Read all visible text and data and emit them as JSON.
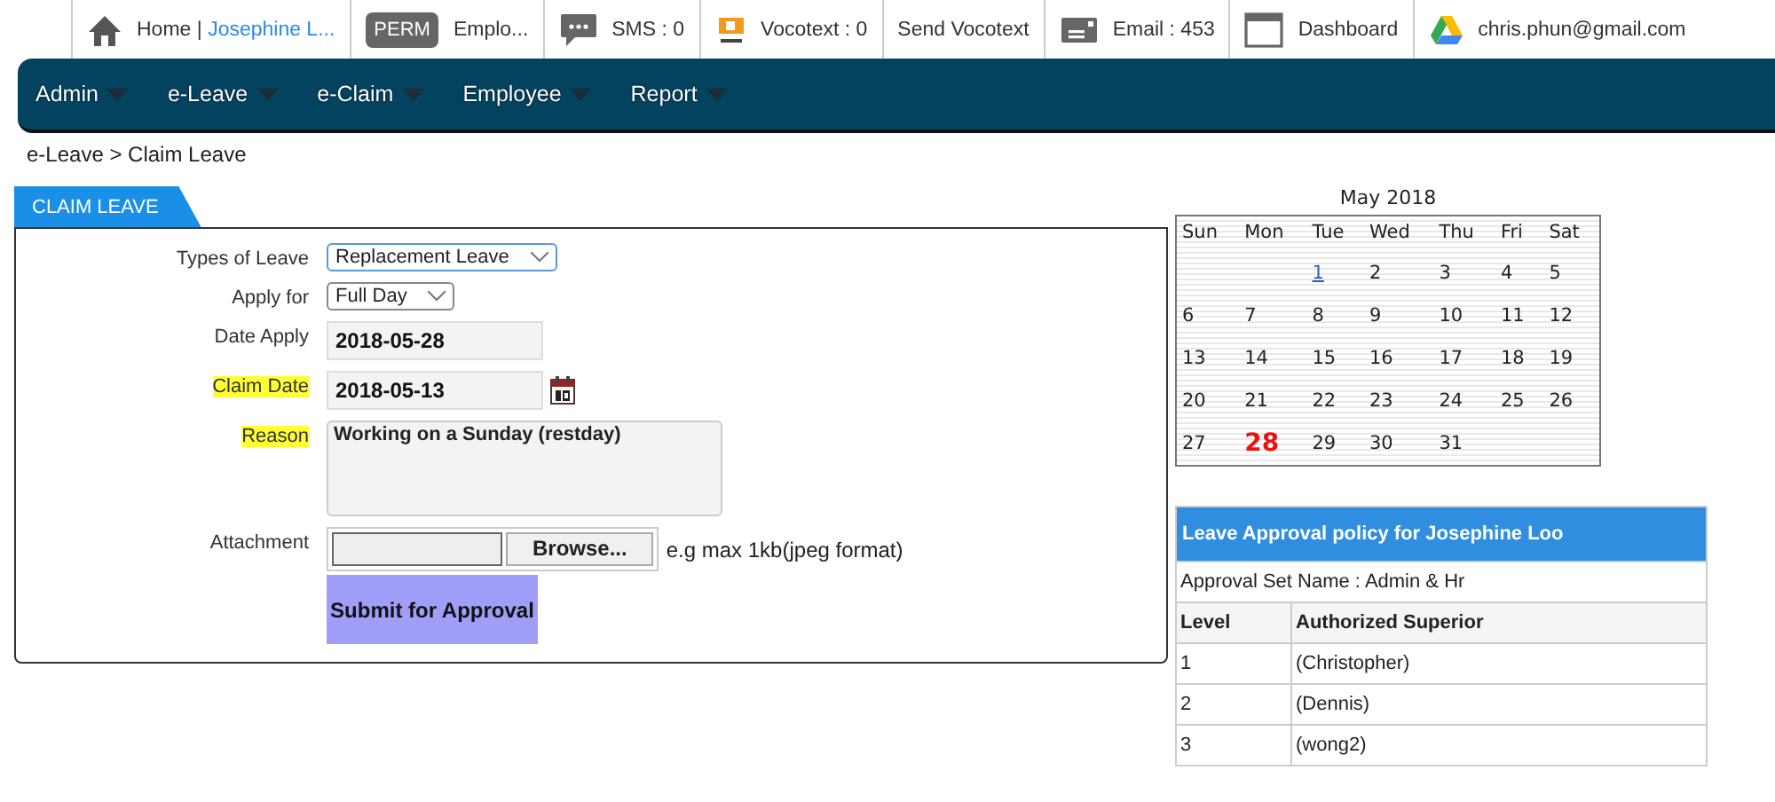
{
  "top_bar": [
    {
      "kind": "home",
      "text": "Home | ",
      "link": "Josephine L..."
    },
    {
      "kind": "badge",
      "badge": "PERM",
      "text": "Emplo..."
    },
    {
      "kind": "chat",
      "text": "SMS : 0"
    },
    {
      "kind": "vocotext",
      "text": "Vocotext : 0"
    },
    {
      "kind": "plain",
      "text": "Send Vocotext"
    },
    {
      "kind": "email",
      "text": "Email : 453"
    },
    {
      "kind": "window",
      "text": "Dashboard"
    },
    {
      "kind": "drive",
      "text": "chris.phun@gmail.com"
    }
  ],
  "menu": [
    {
      "label": "Admin"
    },
    {
      "label": "e-Leave"
    },
    {
      "label": "e-Claim"
    },
    {
      "label": "Employee"
    },
    {
      "label": "Report"
    }
  ],
  "breadcrumb": "e-Leave > Claim Leave",
  "form": {
    "tab": "CLAIM LEAVE",
    "fields": [
      {
        "kind": "select",
        "label": "Types of Leave",
        "highlighted": false,
        "value": "Replacement Leave",
        "focused": true
      },
      {
        "kind": "select",
        "label": "Apply for",
        "highlighted": false,
        "value": "Full Day",
        "focused": false
      },
      {
        "kind": "text",
        "label": "Date Apply",
        "highlighted": false,
        "value": "2018-05-28"
      },
      {
        "kind": "date",
        "label": "Claim Date",
        "highlighted": true,
        "value": "2018-05-13"
      },
      {
        "kind": "textarea",
        "label": "Reason",
        "highlighted": true,
        "value": "Working on a Sunday (restday)"
      },
      {
        "kind": "file",
        "label": "Attachment",
        "highlighted": false,
        "button": "Browse...",
        "hint": "e.g max 1kb(jpeg format)"
      }
    ],
    "submit": "Submit for Approval"
  },
  "calendar": {
    "title": "May 2018",
    "weekdays": [
      "Sun",
      "Mon",
      "Tue",
      "Wed",
      "Thu",
      "Fri",
      "Sat"
    ],
    "weeks": [
      [
        {
          "kind": "blank"
        },
        {
          "kind": "blank"
        },
        {
          "kind": "link",
          "day": "1"
        },
        {
          "kind": "day",
          "day": "2"
        },
        {
          "kind": "day",
          "day": "3"
        },
        {
          "kind": "day",
          "day": "4"
        },
        {
          "kind": "day",
          "day": "5"
        }
      ],
      [
        {
          "kind": "day",
          "day": "6"
        },
        {
          "kind": "day",
          "day": "7"
        },
        {
          "kind": "day",
          "day": "8"
        },
        {
          "kind": "day",
          "day": "9"
        },
        {
          "kind": "day",
          "day": "10"
        },
        {
          "kind": "day",
          "day": "11"
        },
        {
          "kind": "day",
          "day": "12"
        }
      ],
      [
        {
          "kind": "day",
          "day": "13"
        },
        {
          "kind": "day",
          "day": "14"
        },
        {
          "kind": "day",
          "day": "15"
        },
        {
          "kind": "day",
          "day": "16"
        },
        {
          "kind": "day",
          "day": "17"
        },
        {
          "kind": "day",
          "day": "18"
        },
        {
          "kind": "day",
          "day": "19"
        }
      ],
      [
        {
          "kind": "day",
          "day": "20"
        },
        {
          "kind": "day",
          "day": "21"
        },
        {
          "kind": "day",
          "day": "22"
        },
        {
          "kind": "day",
          "day": "23"
        },
        {
          "kind": "day",
          "day": "24"
        },
        {
          "kind": "day",
          "day": "25"
        },
        {
          "kind": "day",
          "day": "26"
        }
      ],
      [
        {
          "kind": "day",
          "day": "27"
        },
        {
          "kind": "today",
          "day": "28"
        },
        {
          "kind": "day",
          "day": "29"
        },
        {
          "kind": "day",
          "day": "30"
        },
        {
          "kind": "day",
          "day": "31"
        },
        {
          "kind": "blank"
        },
        {
          "kind": "blank"
        }
      ]
    ]
  },
  "policy": {
    "title": "Leave Approval policy for Josephine Loo",
    "set_name": "Approval Set Name : Admin & Hr",
    "columns": [
      "Level",
      "Authorized Superior"
    ],
    "rows": [
      [
        "1",
        "(Christopher)"
      ],
      [
        "2",
        "(Dennis)"
      ],
      [
        "3",
        "(wong2)"
      ]
    ]
  }
}
